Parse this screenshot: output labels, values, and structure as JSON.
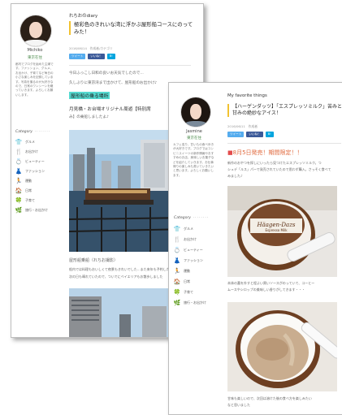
{
  "back_blog": {
    "blog_title": "れちおのdiary",
    "post_title": "極彩色のきれいな湾に浮かぶ屋形船コースにのってみた！",
    "meta": "2016/06/14　作成者/カテゴリ",
    "share": [
      "ツイート",
      "いいね！",
      "B!"
    ],
    "paragraph_1": "今日ふっこし日和の良いお天気でしたので…",
    "paragraph_2": "久しぶりに東京湾まで出かけて、屋形船のお出かけ♪",
    "highlight": "屋形船の乗る場所",
    "section_heading": "月見橋・お台場オリジナル周遊【特別席",
    "section_note": "み】の乗船しましたよ♪",
    "caption": "屋形船乗船（れちお撮影）",
    "paragraph_3": "船内では料理もおいしくて夜景もきれいでした…また来年も予約したい",
    "paragraph_4": "次の日も晴れていたので、ついでにベイエリアもお散歩しました",
    "profile": {
      "name": "Michiko",
      "sub": "東京在住",
      "bio": "都内でブログを始めた主婦です。ファッション、グルメ、お出かけ、子育てなど毎日の小さな楽しみを記録しています。写真を撮るのが大好きなので、日常のワンシーンを綴っていきます。よろしくお願いします。"
    },
    "categories_title": "Category",
    "categories": [
      {
        "icon": "👕",
        "label": "グルメ"
      },
      {
        "icon": "🍴",
        "label": "お出かけ"
      },
      {
        "icon": "💍",
        "label": "ビューティー"
      },
      {
        "icon": "👗",
        "label": "ファッション"
      },
      {
        "icon": "🏃",
        "label": "運動"
      },
      {
        "icon": "🏠",
        "label": "日常"
      },
      {
        "icon": "🍀",
        "label": "子育て"
      },
      {
        "icon": "🌿",
        "label": "旅行・お出かけ"
      }
    ]
  },
  "front_blog": {
    "blog_title": "My favorite things",
    "post_title": "【ハーゲンダッツ】「エスプレッソミルク」苦みと甘みの絶妙なアイス！",
    "meta": "2016/06/11　作成者",
    "share": [
      "ツイート",
      "いいね！",
      "B!"
    ],
    "red_heading_mark": "■",
    "red_heading": "8月5日発売！期間限定！！",
    "paragraph_1": "新作のおやつを探しにいったら見つけたエスプレッソミルク。つ",
    "paragraph_2": "シュデ「ルス」パーで発売されていたので思わず購入。さっそく食べて",
    "paragraph_3": "みました♪",
    "ice_brand": "Häagen-Dazs",
    "ice_flavor": "Espresso Milk",
    "caption_1": "本体の蓋を外すと程よい黒いソースがのっていて、コーヒー",
    "caption_2": "ムースやシロップの美味しい香りがしてきます・・・",
    "caption_3": "甘味も楽しいので、次回は溶けた後の食べ方を楽しみたい",
    "caption_4": "なと思いました",
    "profile": {
      "name": "Jasmine",
      "sub": "東京在住",
      "bio": "カフェ巡り、甘いもの食べ歩きが大好きです。ブログではコンビニスイーツの新作情報やおすすめのお店、美味しいお菓子などを紹介していきます。お仕事帰りの楽しみも書いていきたいと思います。よろしくお願いします。"
    },
    "categories_title": "Category",
    "categories": [
      {
        "icon": "👕",
        "label": "グルメ"
      },
      {
        "icon": "🍴",
        "label": "お出かけ"
      },
      {
        "icon": "💍",
        "label": "ビューティー"
      },
      {
        "icon": "👗",
        "label": "ファッション"
      },
      {
        "icon": "🏃",
        "label": "運動"
      },
      {
        "icon": "🏠",
        "label": "日常"
      },
      {
        "icon": "🍀",
        "label": "子育て"
      },
      {
        "icon": "🌿",
        "label": "旅行・お出かけ"
      }
    ]
  },
  "colors": {
    "title_accent": "#f2c230",
    "highlight": "#55d9d0",
    "red_heading": "#e0693d",
    "twitter": "#55acee",
    "facebook": "#3b5998"
  }
}
